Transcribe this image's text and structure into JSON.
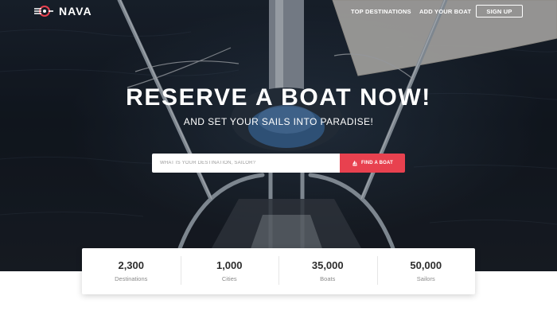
{
  "brand": {
    "name": "NAVA"
  },
  "nav": {
    "links": [
      "TOP DESTINATIONS",
      "ADD YOUR BOAT"
    ],
    "signup_label": "SIGN UP"
  },
  "hero": {
    "headline": "RESERVE A BOAT NOW!",
    "subheadline": "AND SET YOUR SAILS INTO PARADISE!"
  },
  "search": {
    "placeholder": "WHAT IS YOUR DESTINATION, SAILOR?",
    "button_label": "FIND A BOAT",
    "button_icon": "sailboat-icon"
  },
  "stats": [
    {
      "value": "2,300",
      "label": "Destinations"
    },
    {
      "value": "1,000",
      "label": "Cities"
    },
    {
      "value": "35,000",
      "label": "Boats"
    },
    {
      "value": "50,000",
      "label": "Sailors"
    }
  ],
  "colors": {
    "accent": "#e8414f",
    "hero_dark": "#121820",
    "text_dark": "#2d2d2d",
    "text_muted": "#8a8a8a"
  }
}
